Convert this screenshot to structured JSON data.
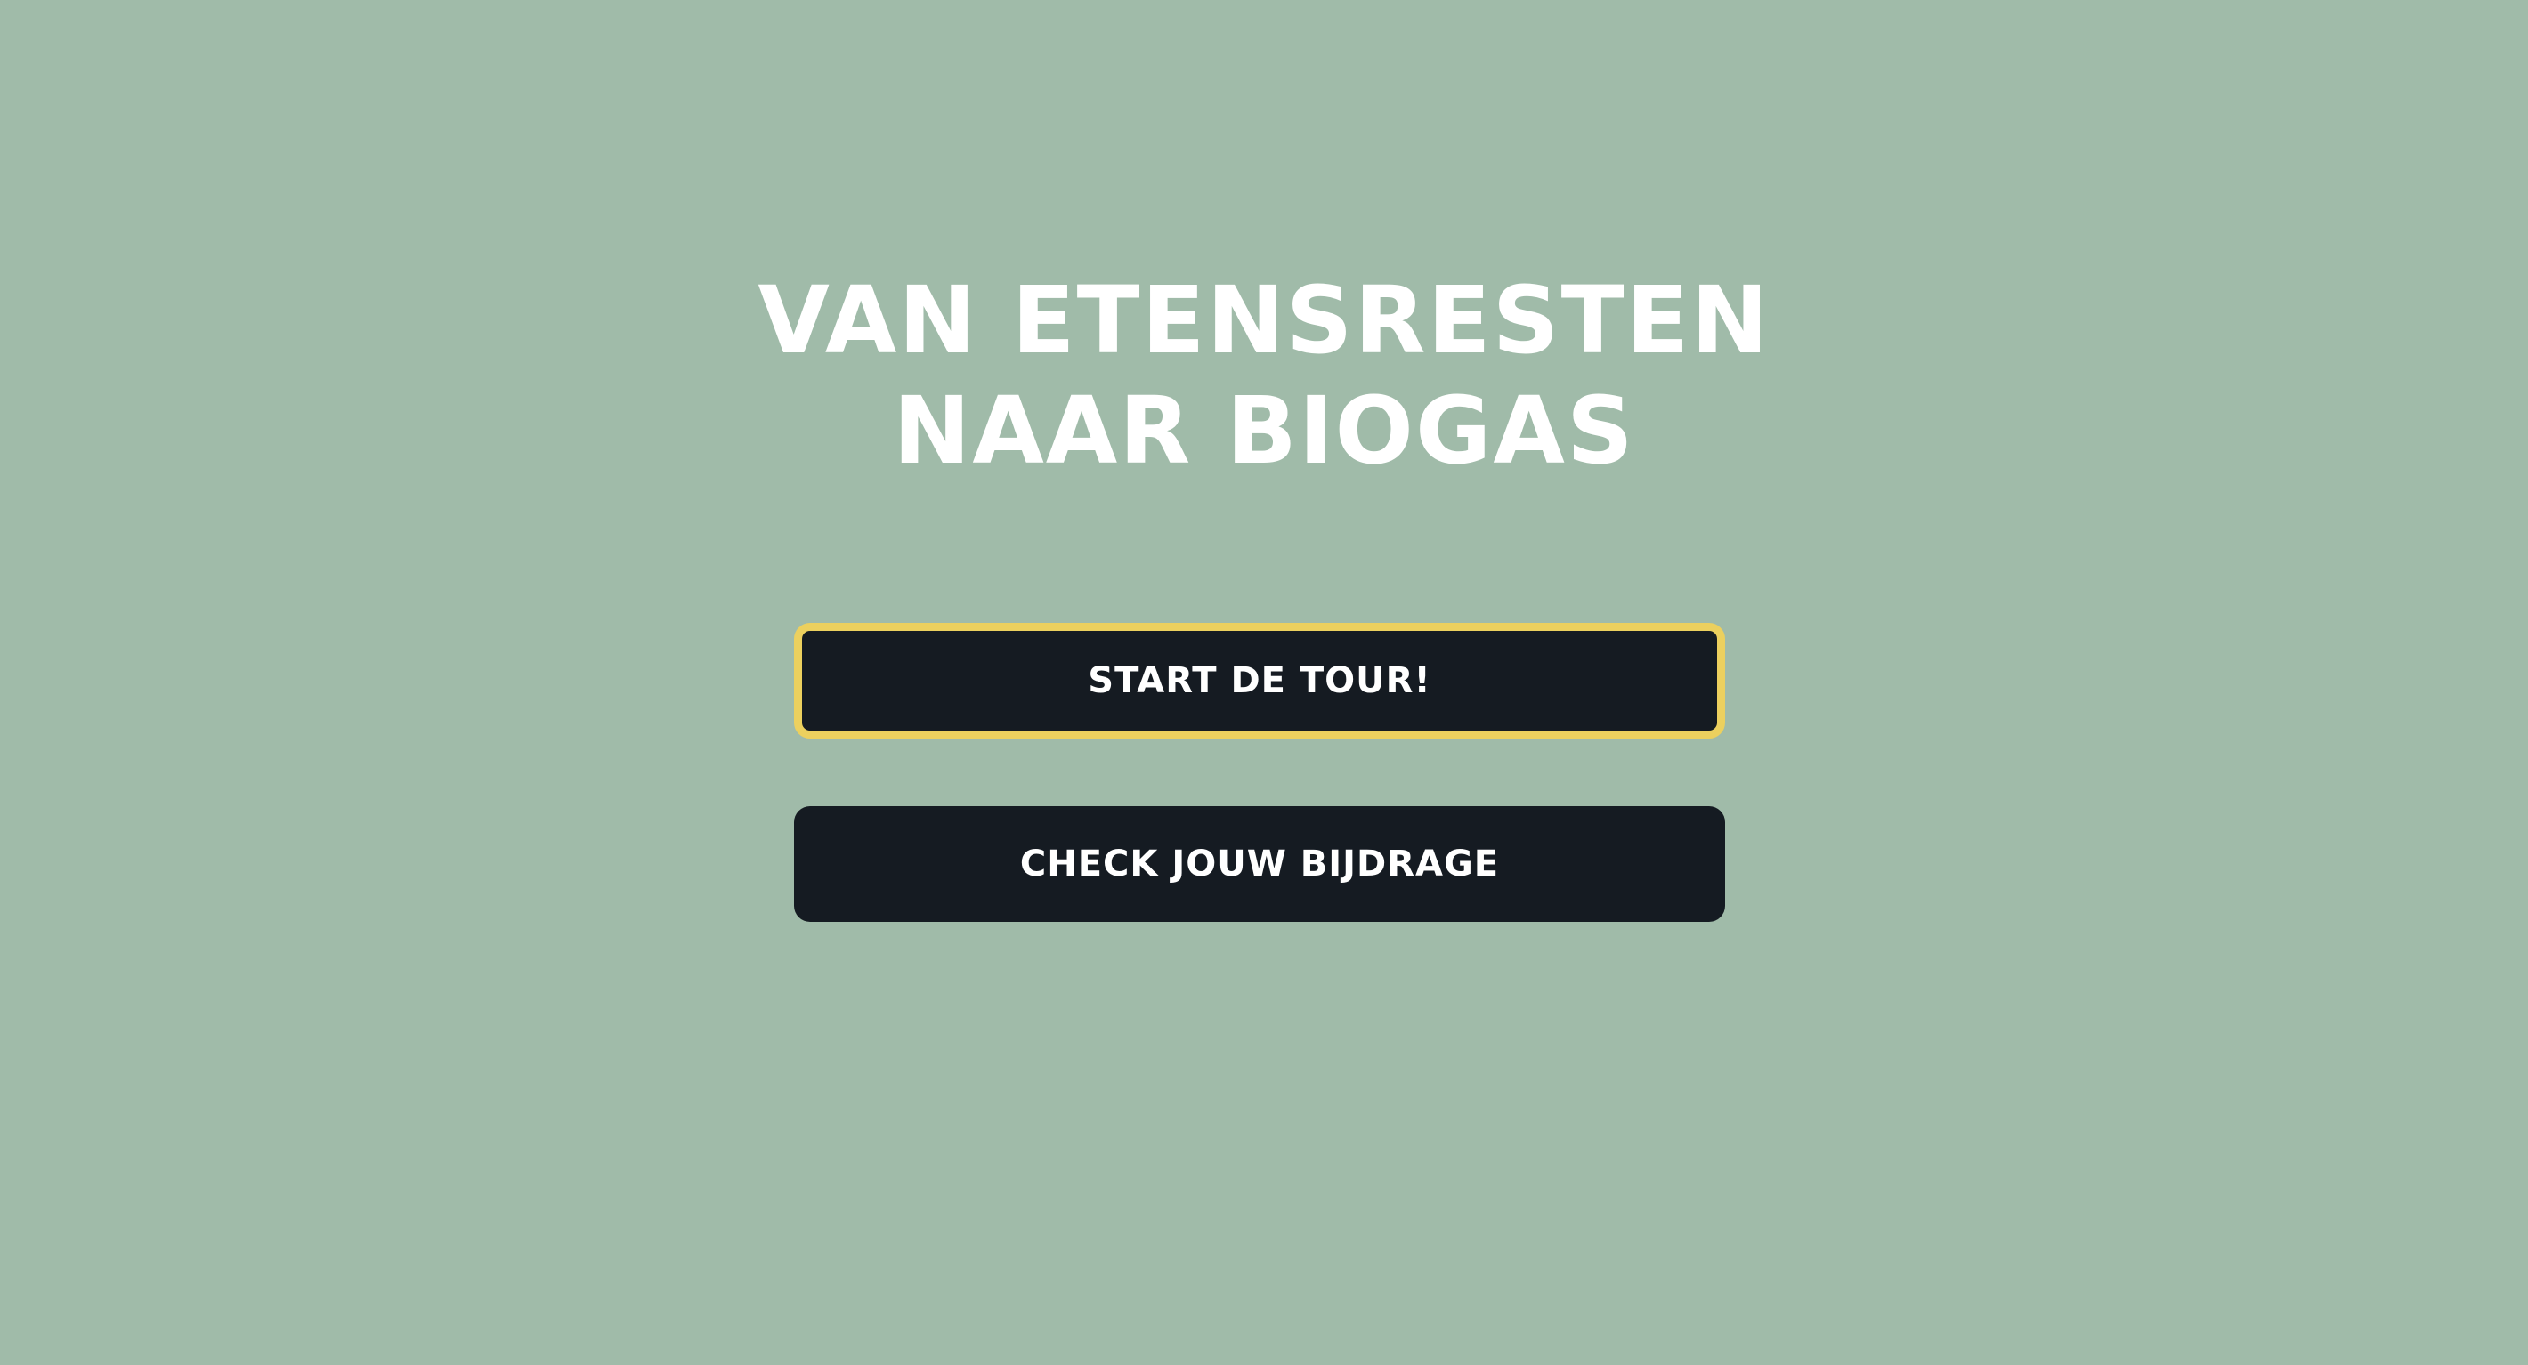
{
  "hero": {
    "title_line_1": "VAN ETENSRESTEN",
    "title_line_2": "NAAR BIOGAS"
  },
  "actions": {
    "start_label": "START DE TOUR!",
    "check_label": "CHECK JOUW BIJDRAGE"
  },
  "colors": {
    "background": "#a0bba9",
    "button": "#151b22",
    "focus_outline": "#ecd05e",
    "text": "#ffffff"
  }
}
